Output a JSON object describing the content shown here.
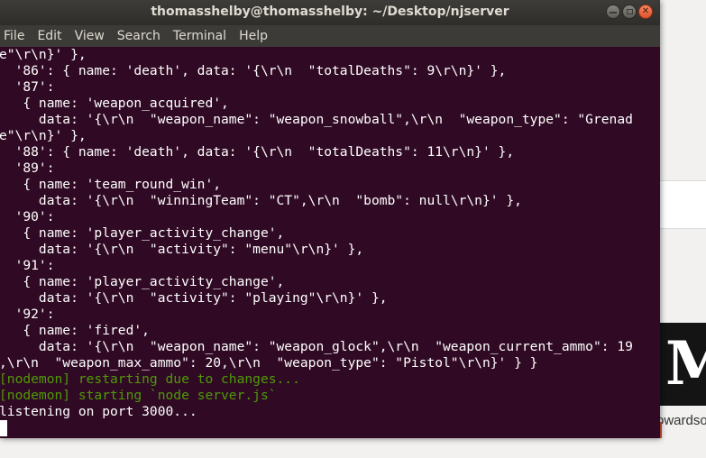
{
  "window": {
    "title": "thomasshelby@thomasshelby: ~/Desktop/njserver"
  },
  "menu": [
    {
      "label": "File"
    },
    {
      "label": "Edit"
    },
    {
      "label": "View"
    },
    {
      "label": "Search"
    },
    {
      "label": "Terminal"
    },
    {
      "label": "Help"
    }
  ],
  "terminal": {
    "lines": [
      {
        "text": "e\"\\r\\n}' },",
        "color": "default"
      },
      {
        "text": "  '86': { name: 'death', data: '{\\r\\n  \"totalDeaths\": 9\\r\\n}' },",
        "color": "default"
      },
      {
        "text": "  '87':",
        "color": "default"
      },
      {
        "text": "   { name: 'weapon_acquired',",
        "color": "default"
      },
      {
        "text": "     data: '{\\r\\n  \"weapon_name\": \"weapon_snowball\",\\r\\n  \"weapon_type\": \"Grenad",
        "color": "default"
      },
      {
        "text": "e\"\\r\\n}' },",
        "color": "default"
      },
      {
        "text": "  '88': { name: 'death', data: '{\\r\\n  \"totalDeaths\": 11\\r\\n}' },",
        "color": "default"
      },
      {
        "text": "  '89':",
        "color": "default"
      },
      {
        "text": "   { name: 'team_round_win',",
        "color": "default"
      },
      {
        "text": "     data: '{\\r\\n  \"winningTeam\": \"CT\",\\r\\n  \"bomb\": null\\r\\n}' },",
        "color": "default"
      },
      {
        "text": "  '90':",
        "color": "default"
      },
      {
        "text": "   { name: 'player_activity_change',",
        "color": "default"
      },
      {
        "text": "     data: '{\\r\\n  \"activity\": \"menu\"\\r\\n}' },",
        "color": "default"
      },
      {
        "text": "  '91':",
        "color": "default"
      },
      {
        "text": "   { name: 'player_activity_change',",
        "color": "default"
      },
      {
        "text": "     data: '{\\r\\n  \"activity\": \"playing\"\\r\\n}' },",
        "color": "default"
      },
      {
        "text": "  '92':",
        "color": "default"
      },
      {
        "text": "   { name: 'fired',",
        "color": "default"
      },
      {
        "text": "     data: '{\\r\\n  \"weapon_name\": \"weapon_glock\",\\r\\n  \"weapon_current_ammo\": 19",
        "color": "default"
      },
      {
        "text": ",\\r\\n  \"weapon_max_ammo\": 20,\\r\\n  \"weapon_type\": \"Pistol\"\\r\\n}' } }",
        "color": "default"
      },
      {
        "text": "[nodemon] restarting due to changes...",
        "color": "green"
      },
      {
        "text": "[nodemon] starting `node server.js`",
        "color": "green"
      },
      {
        "text": "listening on port 3000...",
        "color": "default"
      }
    ]
  },
  "background": {
    "logo_text": "M",
    "peek_text": "owardso"
  },
  "colors": {
    "terminal_bg": "#300a24",
    "terminal_fg": "#ffffff",
    "nodemon_green": "#4e9a06",
    "titlebar": "#3d3c38",
    "close_button": "#e95420"
  }
}
